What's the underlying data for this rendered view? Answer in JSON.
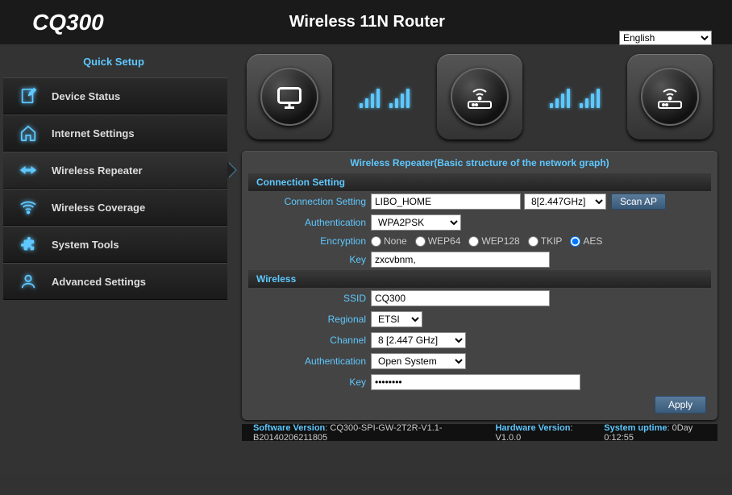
{
  "header": {
    "logo": "CQ300",
    "title": "Wireless 11N Router",
    "language": "English"
  },
  "sidebar": {
    "quick_setup": "Quick Setup",
    "items": [
      {
        "label": "Device Status"
      },
      {
        "label": "Internet Settings"
      },
      {
        "label": "Wireless Repeater"
      },
      {
        "label": "Wireless Coverage"
      },
      {
        "label": "System Tools"
      },
      {
        "label": "Advanced Settings"
      }
    ]
  },
  "panel": {
    "title": "Wireless Repeater(Basic structure of the network graph)",
    "conn_header": "Connection Setting",
    "wireless_header": "Wireless",
    "labels": {
      "conn_setting": "Connection Setting",
      "auth": "Authentication",
      "encryption": "Encryption",
      "key": "Key",
      "ssid": "SSID",
      "regional": "Regional",
      "channel": "Channel"
    },
    "values": {
      "ssid_target": "LIBO_HOME",
      "channel_target": "8[2.447GHz]",
      "auth_conn": "WPA2PSK",
      "key_conn": "zxcvbnm,",
      "ssid_local": "CQ300",
      "regional": "ETSI",
      "channel_local": "8 [2.447 GHz]",
      "auth_local": "Open System",
      "key_local": "••••••••"
    },
    "enc_options": [
      "None",
      "WEP64",
      "WEP128",
      "TKIP",
      "AES"
    ],
    "enc_selected": "AES",
    "buttons": {
      "scan": "Scan AP",
      "apply": "Apply"
    }
  },
  "footer": {
    "sw_k": "Software Version",
    "sw_v": "CQ300-SPI-GW-2T2R-V1.1-B20140206211805",
    "hw_k": "Hardware Version",
    "hw_v": "V1.0.0",
    "up_k": "System uptime",
    "up_v": "0Day 0:12:55"
  }
}
